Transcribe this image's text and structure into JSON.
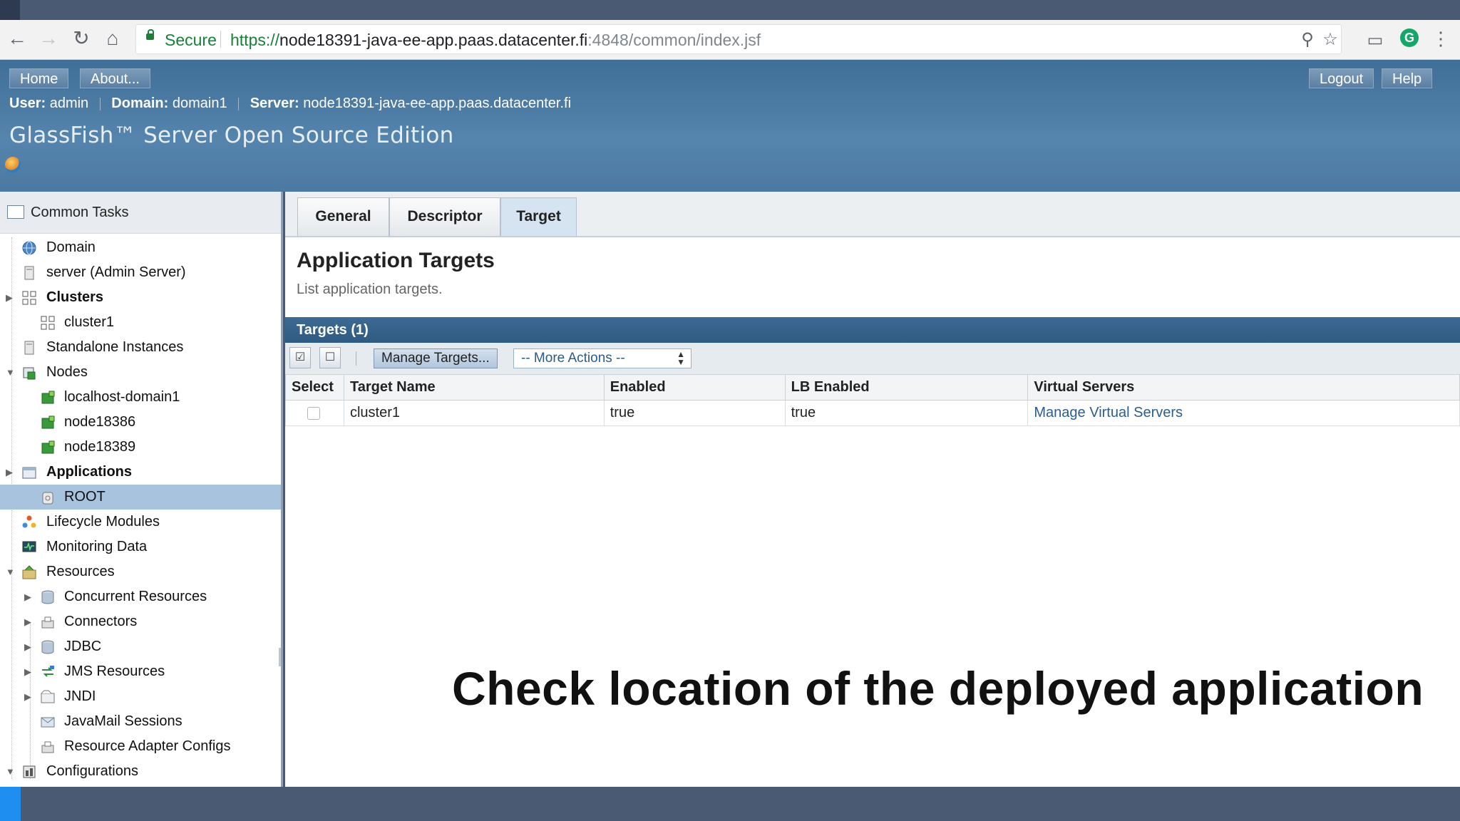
{
  "browser": {
    "secure_label": "Secure",
    "url_scheme": "https://",
    "url_host": "node18391-java-ee-app.paas.datacenter.fi",
    "url_rest": ":4848/common/index.jsf",
    "profile_letter": "G"
  },
  "masthead": {
    "home": "Home",
    "about": "About...",
    "logout": "Logout",
    "help": "Help",
    "user_key": "User:",
    "user_val": " admin",
    "domain_key": "Domain:",
    "domain_val": " domain1",
    "server_key": "Server:",
    "server_val": " node18391-java-ee-app.paas.datacenter.fi",
    "product": "GlassFish™ Server Open Source Edition"
  },
  "sidebar": {
    "header": "Common Tasks",
    "items": [
      {
        "label": "Domain"
      },
      {
        "label": "server (Admin Server)"
      },
      {
        "label": "Clusters"
      },
      {
        "label": "cluster1"
      },
      {
        "label": "Standalone Instances"
      },
      {
        "label": "Nodes"
      },
      {
        "label": "localhost-domain1"
      },
      {
        "label": "node18386"
      },
      {
        "label": "node18389"
      },
      {
        "label": "Applications"
      },
      {
        "label": "ROOT"
      },
      {
        "label": "Lifecycle Modules"
      },
      {
        "label": "Monitoring Data"
      },
      {
        "label": "Resources"
      },
      {
        "label": "Concurrent Resources"
      },
      {
        "label": "Connectors"
      },
      {
        "label": "JDBC"
      },
      {
        "label": "JMS Resources"
      },
      {
        "label": "JNDI"
      },
      {
        "label": "JavaMail Sessions"
      },
      {
        "label": "Resource Adapter Configs"
      },
      {
        "label": "Configurations"
      }
    ]
  },
  "main": {
    "tabs": [
      {
        "label": "General"
      },
      {
        "label": "Descriptor"
      },
      {
        "label": "Target"
      }
    ],
    "title": "Application Targets",
    "subtitle": "List application targets.",
    "table_title": "Targets (1)",
    "manage_targets": "Manage Targets...",
    "more_actions": "-- More Actions --",
    "columns": [
      "Select",
      "Target Name",
      "Enabled",
      "LB Enabled",
      "Virtual Servers"
    ],
    "rows": [
      {
        "target": "cluster1",
        "enabled": "true",
        "lb_enabled": "true",
        "virtual_servers": "Manage Virtual Servers"
      }
    ]
  },
  "caption": "Check location of the deployed application",
  "colors": {
    "masthead": "#5584ad",
    "selection": "#a7c3de",
    "link": "#2c5d8f",
    "accent": "#1f8ef1"
  }
}
